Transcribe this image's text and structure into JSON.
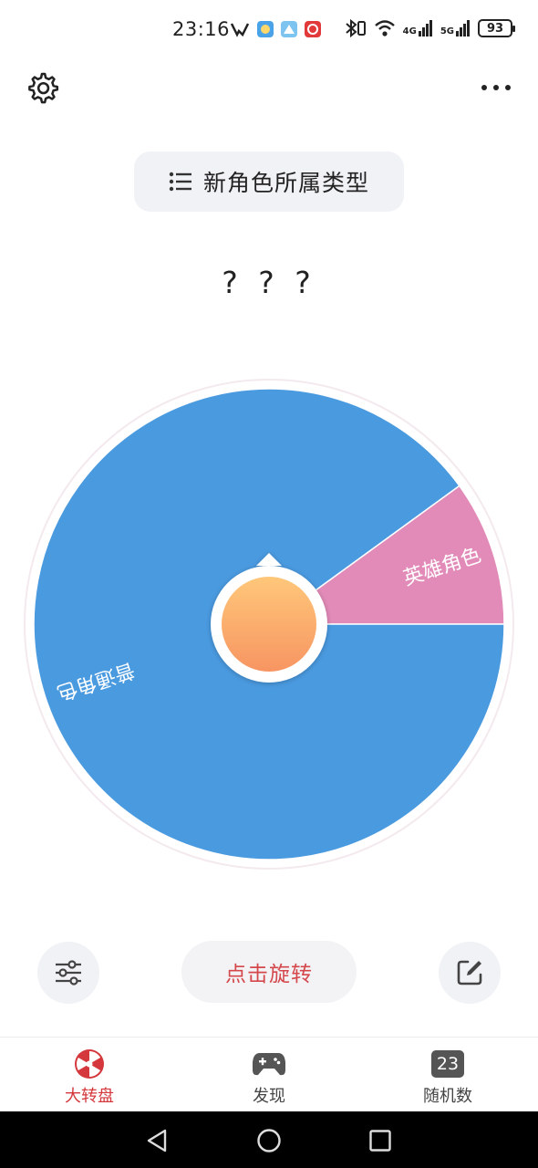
{
  "status_bar": {
    "time": "23:16",
    "signal_4g": "4G",
    "signal_5g": "5G",
    "battery": "93"
  },
  "header": {
    "title": "新角色所属类型"
  },
  "result_text": "? ? ?",
  "wheel": {
    "segments": [
      {
        "label": "普通角色",
        "fraction": 0.9,
        "color": "#4a9ae0"
      },
      {
        "label": "英雄角色",
        "fraction": 0.1,
        "color": "#e28bb8"
      }
    ],
    "hub_color_top": "#ffc77a",
    "hub_color_bottom": "#f79562"
  },
  "controls": {
    "spin_label": "点击旋转"
  },
  "bottom_nav": {
    "items": [
      {
        "label": "大转盘",
        "icon": "wheel-icon"
      },
      {
        "label": "发现",
        "icon": "gamepad-icon"
      },
      {
        "label": "随机数",
        "icon": "number-23-icon",
        "badge": "23"
      }
    ],
    "accent": "#d4383c"
  }
}
